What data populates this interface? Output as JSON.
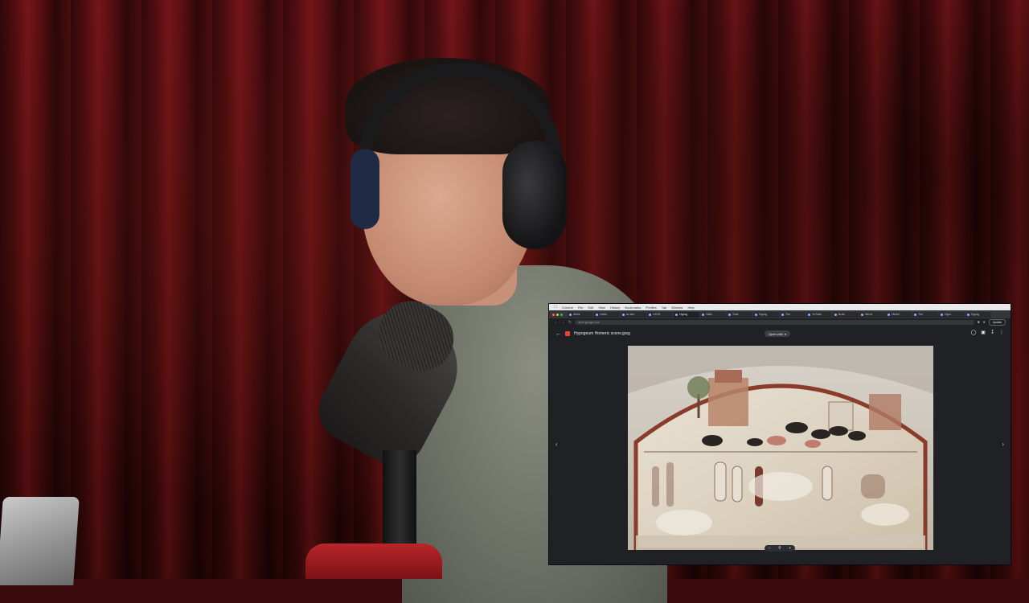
{
  "scene": {
    "description_free": true
  },
  "mac_menubar": {
    "items": [
      "Chrome",
      "File",
      "Edit",
      "View",
      "History",
      "Bookmarks",
      "Profiles",
      "Tab",
      "Window",
      "Help"
    ]
  },
  "browser": {
    "tabs": [
      "Aleks",
      "Calibr",
      "ac stre",
      "LSGS",
      "Hypog",
      "Hallu",
      "Tobe",
      "Hypog",
      "The",
      "YuTube",
      "Brain",
      "Nerve",
      "Heidel",
      "The",
      "Hypo",
      "Hypog"
    ],
    "active_tab_index": 4,
    "url": "drive.google.com",
    "update_label": "Update"
  },
  "drive": {
    "file_name": "Hypogeum Homeric scene.jpeg",
    "open_with_label": "Open with"
  },
  "colors": {
    "traffic_red": "#ff5f57",
    "traffic_yellow": "#febc2e",
    "traffic_green": "#28c840",
    "file_icon": "#ea4335"
  }
}
